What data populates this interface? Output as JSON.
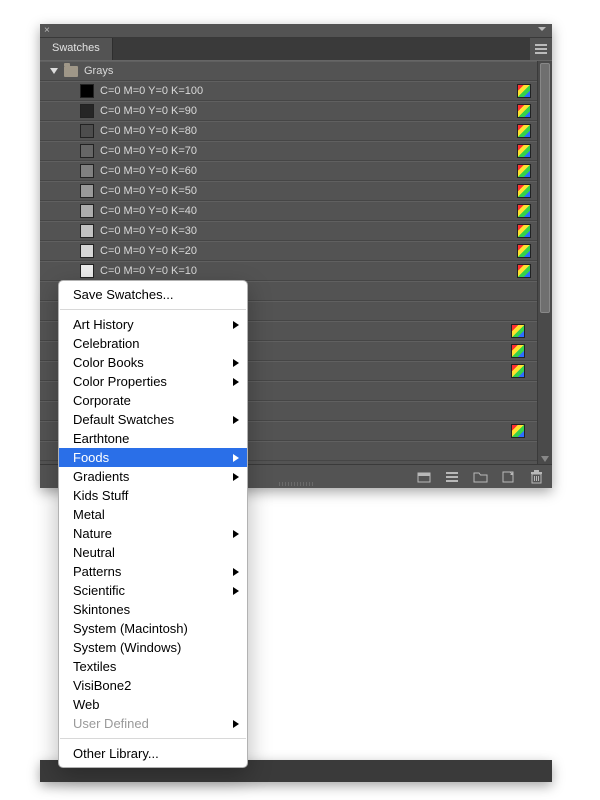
{
  "panel": {
    "tab_label": "Swatches",
    "folder_name": "Grays"
  },
  "swatches": [
    {
      "label": "C=0 M=0 Y=0 K=100",
      "color": "#000000"
    },
    {
      "label": "C=0 M=0 Y=0 K=90",
      "color": "#262626"
    },
    {
      "label": "C=0 M=0 Y=0 K=80",
      "color": "#4d4d4d"
    },
    {
      "label": "C=0 M=0 Y=0 K=70",
      "color": "#666666"
    },
    {
      "label": "C=0 M=0 Y=0 K=60",
      "color": "#808080"
    },
    {
      "label": "C=0 M=0 Y=0 K=50",
      "color": "#999999"
    },
    {
      "label": "C=0 M=0 Y=0 K=40",
      "color": "#adadad"
    },
    {
      "label": "C=0 M=0 Y=0 K=30",
      "color": "#c2c2c2"
    },
    {
      "label": "C=0 M=0 Y=0 K=20",
      "color": "#d6d6d6"
    },
    {
      "label": "C=0 M=0 Y=0 K=10",
      "color": "#ebebeb"
    }
  ],
  "popup": {
    "save_label": "Save Swatches...",
    "other_library_label": "Other Library...",
    "items": [
      {
        "label": "Art History",
        "submenu": true
      },
      {
        "label": "Celebration",
        "submenu": false
      },
      {
        "label": "Color Books",
        "submenu": true
      },
      {
        "label": "Color Properties",
        "submenu": true
      },
      {
        "label": "Corporate",
        "submenu": false
      },
      {
        "label": "Default Swatches",
        "submenu": true
      },
      {
        "label": "Earthtone",
        "submenu": false
      },
      {
        "label": "Foods",
        "submenu": true,
        "highlight": true
      },
      {
        "label": "Gradients",
        "submenu": true
      },
      {
        "label": "Kids Stuff",
        "submenu": false
      },
      {
        "label": "Metal",
        "submenu": false
      },
      {
        "label": "Nature",
        "submenu": true
      },
      {
        "label": "Neutral",
        "submenu": false
      },
      {
        "label": "Patterns",
        "submenu": true
      },
      {
        "label": "Scientific",
        "submenu": true
      },
      {
        "label": "Skintones",
        "submenu": false
      },
      {
        "label": "System (Macintosh)",
        "submenu": false
      },
      {
        "label": "System (Windows)",
        "submenu": false
      },
      {
        "label": "Textiles",
        "submenu": false
      },
      {
        "label": "VisiBone2",
        "submenu": false
      },
      {
        "label": "Web",
        "submenu": false
      },
      {
        "label": "User Defined",
        "submenu": true,
        "disabled": true
      }
    ]
  }
}
